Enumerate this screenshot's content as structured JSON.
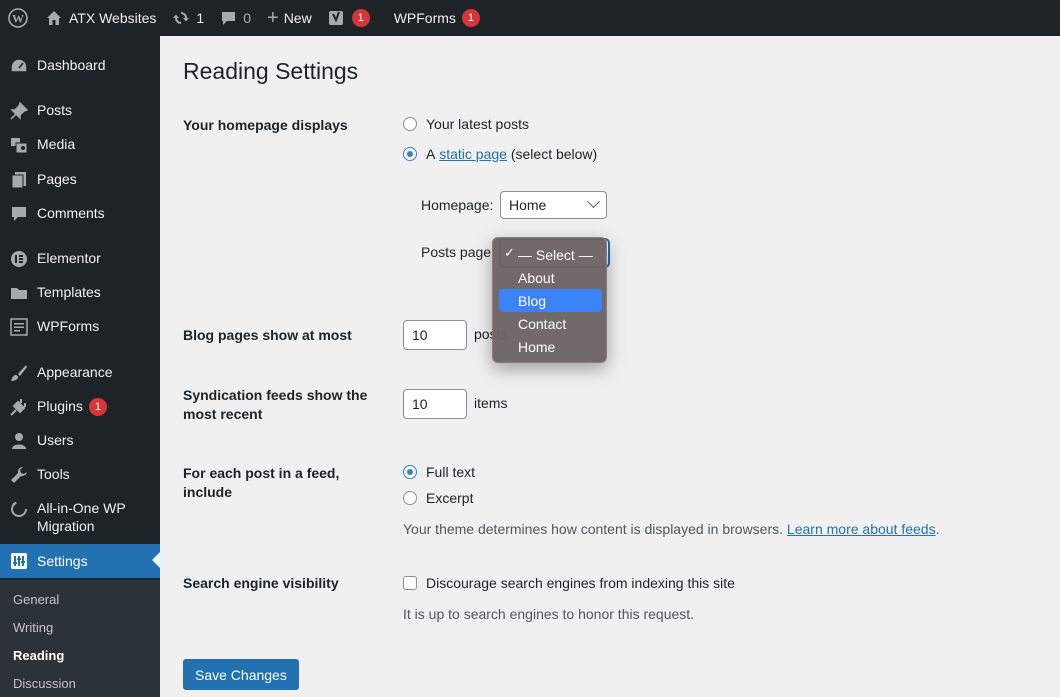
{
  "adminbar": {
    "site_name": "ATX Websites",
    "updates_count": "1",
    "comments_count": "0",
    "new_label": "New",
    "yoast_badge": "1",
    "wpforms_label": "WPForms",
    "wpforms_badge": "1"
  },
  "sidebar": {
    "items": [
      {
        "label": "Dashboard",
        "icon": "dashboard-icon"
      },
      {
        "label": "Posts",
        "icon": "pin-icon"
      },
      {
        "label": "Media",
        "icon": "media-icon"
      },
      {
        "label": "Pages",
        "icon": "pages-icon"
      },
      {
        "label": "Comments",
        "icon": "comment-icon"
      },
      {
        "label": "Elementor",
        "icon": "elementor-icon"
      },
      {
        "label": "Templates",
        "icon": "folder-icon"
      },
      {
        "label": "WPForms",
        "icon": "forms-icon"
      },
      {
        "label": "Appearance",
        "icon": "brush-icon"
      },
      {
        "label": "Plugins",
        "icon": "plugin-icon",
        "badge": "1"
      },
      {
        "label": "Users",
        "icon": "user-icon"
      },
      {
        "label": "Tools",
        "icon": "wrench-icon"
      },
      {
        "label": "All-in-One WP",
        "label2": "Migration",
        "icon": "migration-icon"
      },
      {
        "label": "Settings",
        "icon": "settings-icon",
        "current": true
      }
    ],
    "submenu": [
      "General",
      "Writing",
      "Reading",
      "Discussion"
    ],
    "current_sub": "Reading"
  },
  "page": {
    "title": "Reading Settings",
    "homepage_displays": {
      "label": "Your homepage displays",
      "option_latest": "Your latest posts",
      "option_static_prefix": "A",
      "option_static_link": "static page",
      "option_static_suffix": "(select below)",
      "selected": "static",
      "homepage_label": "Homepage:",
      "homepage_value": "Home",
      "posts_page_label": "Posts page:"
    },
    "posts_page_dropdown": {
      "options": [
        "— Select —",
        "About",
        "Blog",
        "Contact",
        "Home"
      ],
      "checked": "— Select —",
      "highlighted": "Blog"
    },
    "blog_pages": {
      "label": "Blog pages show at most",
      "value": "10",
      "unit": "posts"
    },
    "syndication": {
      "label": "Syndication feeds show the most recent",
      "value": "10",
      "unit": "items"
    },
    "feed_include": {
      "label": "For each post in a feed, include",
      "option_full": "Full text",
      "option_excerpt": "Excerpt",
      "selected": "full",
      "desc_prefix": "Your theme determines how content is displayed in browsers.",
      "desc_link": "Learn more about feeds",
      "desc_suffix": "."
    },
    "search_visibility": {
      "label": "Search engine visibility",
      "checkbox_label": "Discourage search engines from indexing this site",
      "checked": false,
      "desc": "It is up to search engines to honor this request."
    },
    "save_button": "Save Changes"
  },
  "colors": {
    "accent": "#2271b1",
    "sidebar_bg": "#1d2327",
    "badge": "#d63638"
  }
}
